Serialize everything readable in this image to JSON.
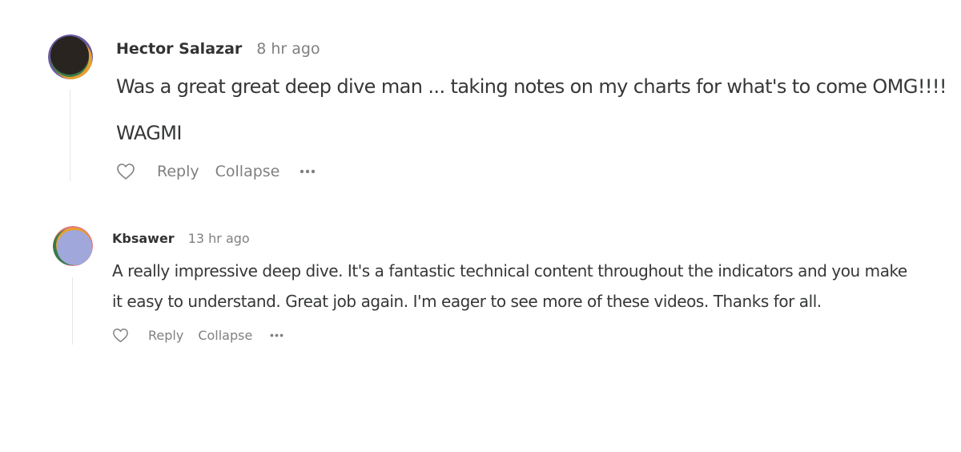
{
  "comments": [
    {
      "author": "Hector Salazar",
      "time": "8 hr ago",
      "paragraphs": [
        "Was a great great deep dive man ... taking notes on my charts for what's to come OMG!!!!",
        "WAGMI"
      ],
      "actions": {
        "like_icon": "heart-icon",
        "reply": "Reply",
        "collapse": "Collapse",
        "more_icon": "more-dots-icon"
      },
      "avatar_colors": [
        "#2a2420",
        "#e8a030",
        "#3a7a4a",
        "#6a5aa0"
      ]
    },
    {
      "author": "Kbsawer",
      "time": "13 hr ago",
      "paragraphs": [
        "A really impressive deep dive. It's a fantastic technical content throughout the indicators and you make",
        "it easy to understand. Great job again. I'm eager to see more of these videos. Thanks for all."
      ],
      "actions": {
        "like_icon": "heart-icon",
        "reply": "Reply",
        "collapse": "Collapse",
        "more_icon": "more-dots-icon"
      },
      "avatar_colors": [
        "#9fa7db",
        "#e8a030",
        "#3a7a4a",
        "#e07a80"
      ]
    }
  ]
}
